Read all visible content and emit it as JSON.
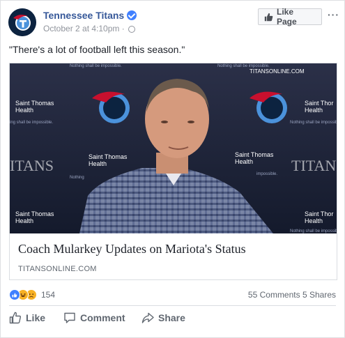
{
  "header": {
    "page_name": "Tennessee Titans",
    "date": "October 2 at 4:10pm",
    "separator": "·",
    "like_page_label": "Like Page",
    "more_label": "···"
  },
  "post": {
    "text": "\"There's a lot of football left this season.\""
  },
  "link_card": {
    "title": "Coach Mularkey Updates on Mariota's Status",
    "domain": "TITANSONLINE.COM",
    "image_texts": {
      "sponsor": "Saint Thomas\nHealth",
      "site": "TITANSONLINE.COM",
      "team": "TITANS",
      "tagline": "Nothing shall be impossible."
    }
  },
  "reactions": {
    "count": "154",
    "comments": "55 Comments",
    "shares": "5 Shares"
  },
  "actions": {
    "like": "Like",
    "comment": "Comment",
    "share": "Share"
  },
  "colors": {
    "link_blue": "#365899",
    "verified_blue": "#4080ff",
    "meta_gray": "#90949c",
    "titans_navy": "#0c2340"
  }
}
